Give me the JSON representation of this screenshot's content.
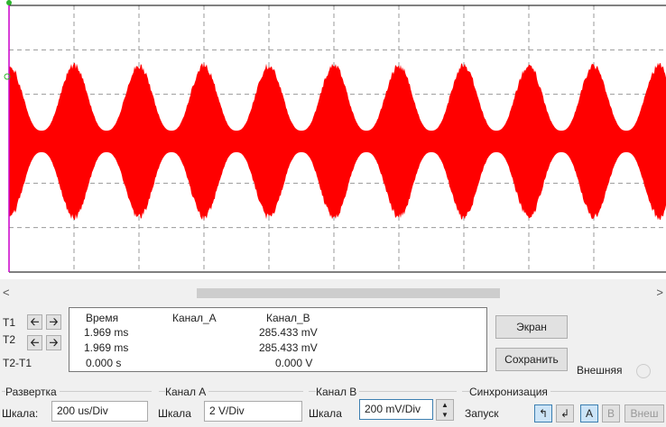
{
  "cursors": {
    "t1": "T1",
    "t2": "T2",
    "t2t1": "T2-T1"
  },
  "readout": {
    "headers": [
      "Время",
      "Канал_A",
      "Канал_B"
    ],
    "rows": [
      [
        "1.969 ms",
        "",
        "285.433 mV"
      ],
      [
        "1.969 ms",
        "",
        "285.433 mV"
      ],
      [
        "0.000 s",
        "",
        "0.000 V"
      ]
    ]
  },
  "buttons": {
    "screen": "Экран",
    "save": "Сохранить",
    "external": "Внешняя"
  },
  "timebase": {
    "title": "Развертка",
    "scale_label": "Шкала:",
    "scale": "200 us/Div"
  },
  "channel_a": {
    "title": "Канал А",
    "scale_label": "Шкала",
    "scale": "2  V/Div"
  },
  "channel_b": {
    "title": "Канал В",
    "scale_label": "Шкала",
    "scale": "200 mV/Div"
  },
  "trigger": {
    "title": "Синхронизация",
    "label": "Запуск",
    "src_a": "A",
    "src_b": "B",
    "src_ext": "Внеш"
  },
  "colors": {
    "trace_b": "#ff0000",
    "cursor": "#cc00cc"
  }
}
